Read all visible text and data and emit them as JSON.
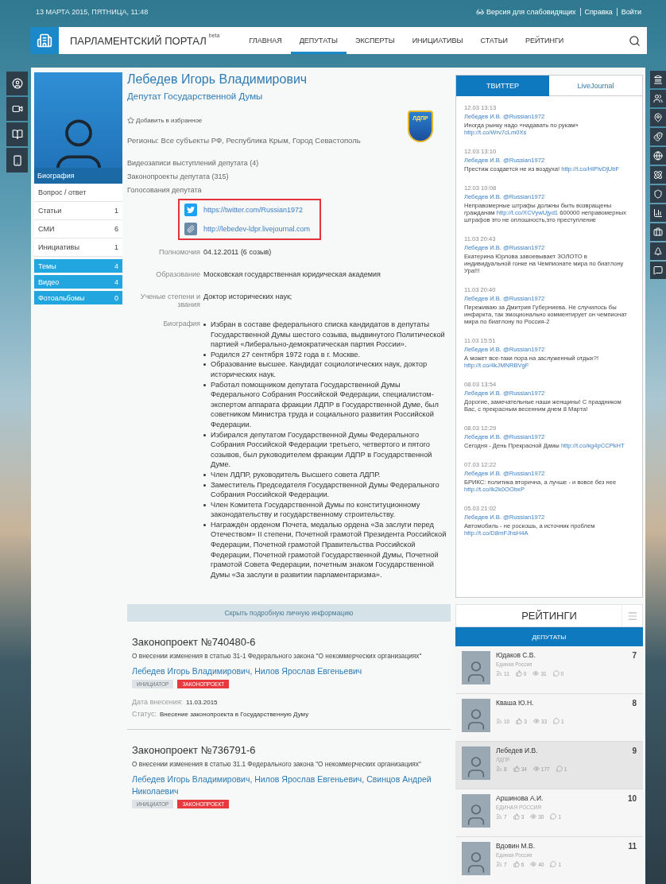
{
  "top_bar": {
    "date": "13 МАРТА 2015, ПЯТНИЦА, 11:48",
    "links": [
      {
        "label": "Версия для слабовидящих",
        "kind": "accessibility"
      },
      {
        "label": "Справка",
        "kind": "plain"
      },
      {
        "label": "Войти",
        "kind": "plain"
      }
    ]
  },
  "site": {
    "title": "ПАРЛАМЕНТСКИЙ ПОРТАЛ",
    "badge": "beta"
  },
  "nav": [
    {
      "label": "ГЛАВНАЯ",
      "selected": false
    },
    {
      "label": "ДЕПУТАТЫ",
      "selected": true
    },
    {
      "label": "ЭКСПЕРТЫ",
      "selected": false
    },
    {
      "label": "ИНИЦИАТИВЫ",
      "selected": false
    },
    {
      "label": "СТАТЬИ",
      "selected": false
    },
    {
      "label": "РЕЙТИНГИ",
      "selected": false
    }
  ],
  "side_menu": {
    "photo_caption": "Биография",
    "items": [
      {
        "label": "Вопрос / ответ",
        "kind": "plain"
      },
      {
        "label": "Статьи",
        "count": "1",
        "kind": "plain"
      },
      {
        "label": "СМИ",
        "count": "6",
        "kind": "plain"
      },
      {
        "label": "Инициативы",
        "count": "1",
        "kind": "plain"
      },
      {
        "label": "Темы",
        "count": "4",
        "kind": "accent"
      },
      {
        "label": "Видео",
        "count": "4",
        "kind": "accent"
      },
      {
        "label": "Фотоальбомы",
        "count": "0",
        "kind": "accent"
      }
    ]
  },
  "profile": {
    "name": "Лебедев Игорь Владимирович",
    "position": "Депутат Государственной Думы",
    "favorite": "Добавить в избранное",
    "party_logo": "ЛДПР",
    "regions": "Регионы: Все субъекты РФ, Республика Крым, Город Севастополь",
    "links": [
      "Видеозаписи выступлений депутата (4)",
      "Законопроекты депутата (315)",
      "Голосования депутата"
    ],
    "social": [
      {
        "kind": "twitter",
        "url": "https://twitter.com/Russian1972"
      },
      {
        "kind": "livejournal",
        "url": "http://lebedev-ldpr.livejournal.com"
      }
    ],
    "details": [
      {
        "label": "Полномочия",
        "value": "04.12.2011 (6 созыв)"
      },
      {
        "label": "Образование",
        "value": "Московская государственная юридическая академия"
      },
      {
        "label": "Ученые степени и звания",
        "value": "Доктор исторических наук;"
      }
    ],
    "biography": {
      "label": "Биография",
      "items": [
        "Избран в составе федерального списка кандидатов в депутаты Государственной Думы шестого созыва, выдвинутого Политической партией «Либерально-демократическая партия России».",
        "Родился 27 сентября 1972 года в г. Москве.",
        "Образование высшее. Кандидат социологических наук, доктор исторических наук.",
        "Работал помощником депутата Государственной Думы Федерального Собрания Российской Федерации, специалистом-экспертом аппарата фракции ЛДПР в Государственной Думе, был советником Министра труда и социального развития Российской Федерации.",
        "Избирался депутатом Государственной Думы Федерального Собрания Российской Федерации третьего, четвертого и пятого созывов, был руководителем фракции ЛДПР в Государственной Думе.",
        "Член ЛДПР, руководитель Высшего совета ЛДПР.",
        "Заместитель Председателя Государственной Думы Федерального Собрания Российской Федерации.",
        "Член Комитета Государственной Думы по конституционному законодательству и государственному строительству.",
        "Награждён орденом Почета, медалью ордена «За заслуги перед Отечеством» II степени, Почетной грамотой Президента Российской Федерации, Почетной грамотой Правительства Российской Федерации, Почетной грамотой Государственной Думы, Почетной грамотой Совета Федерации, почетным знаком Государственной Думы «За заслуги в развитии парламентаризма»."
      ]
    },
    "hide_button": "Скрыть подробную личную информацию"
  },
  "bills": [
    {
      "title": "Законопроект №740480-6",
      "description": "О внесении изменения в статью 31-1 Федерального закона \"О некоммерческих организациях\"",
      "authors": "Лебедев Игорь Владимирович, Нилов Ярослав Евгеньевич",
      "tags": [
        {
          "label": "ИНИЦИАТОР",
          "kind": "role"
        },
        {
          "label": "ЗАКОНОПРОЕКТ",
          "kind": "type"
        }
      ],
      "date_label": "Дата внесения:",
      "date": "11.03.2015",
      "status_label": "Статус:",
      "status": "Внесение законопроекта в Государственную Думу"
    },
    {
      "title": "Законопроект №736791-6",
      "description": "О внесении изменения в статью 31.1 Федерального закона \"О некоммерческих организациях\"",
      "authors": "Лебедев Игорь Владимирович, Нилов Ярослав Евгеньевич, Свинцов Андрей Николаевич",
      "tags": [
        {
          "label": "ИНИЦИАТОР",
          "kind": "role"
        },
        {
          "label": "ЗАКОНОПРОЕКТ",
          "kind": "type"
        }
      ]
    }
  ],
  "feed": {
    "tabs": [
      {
        "label": "ТВИТТЕР",
        "selected": true
      },
      {
        "label": "LiveJournal",
        "selected": false
      }
    ],
    "tweets": [
      {
        "time": "12.03 13:13",
        "author": "Лебедев И.В. @Russian1972",
        "text": "Иногда рынку надо «надавать по рукам»",
        "link": "http://t.co/Wrv7cLm0Xs"
      },
      {
        "time": "12.03 13:10",
        "author": "Лебедев И.В. @Russian1972",
        "text": "Престиж создается не из воздуха!",
        "link": "http://t.co/HIPlvDjUbF"
      },
      {
        "time": "12.03 10:08",
        "author": "Лебедев И.В. @Russian1972",
        "text": "Неправомерные штрафы должны быть возвращены гражданам",
        "link": "http://t.co/XCVywUjyd1",
        "after": "600000 неправомерных штрафов это не оплошность,это преступление"
      },
      {
        "time": "11.03 20:43",
        "author": "Лебедев И.В. @Russian1972",
        "text": "Екатерина Юрлова завоевывает ЗОЛОТО в индивидуальной гонке на Чемпионате мира по биатлону Ура!!!"
      },
      {
        "time": "11.03 20:40",
        "author": "Лебедев И.В. @Russian1972",
        "text": "Переживаю за Дмитрия Губерниева. Не случилось бы инфаркта, так эмоционально комментирует он чемпионат мира по биатлону по Россия-2"
      },
      {
        "time": "11.03 15:51",
        "author": "Лебедев И.В. @Russian1972",
        "text": "А может все-таки пора на заслуженный отдых?!",
        "link": "http://t.co/4kJMNRBVgF"
      },
      {
        "time": "08.03 13:54",
        "author": "Лебедев И.В. @Russian1972",
        "text": "Дорогие, замечательные наши женщины! С праздником Вас, с прекрасным весенним днем 8 Марта!"
      },
      {
        "time": "08.03 12:29",
        "author": "Лебедев И.В. @Russian1972",
        "text": "Сегодня - День Прекрасной Дамы",
        "link": "http://t.co/kg4pCCPkHT"
      },
      {
        "time": "07.03 12:22",
        "author": "Лебедев И.В. @Russian1972",
        "text": "БРИКС: политика вторична, а лучше - и вовсе без нее",
        "link": "http://t.co/lk2k0OObxP"
      },
      {
        "time": "05.03 21:02",
        "author": "Лебедев И.В. @Russian1972",
        "text": "Автомобиль - не роскошь, а источник проблем",
        "link": "http://t.co/D8mFJhsH4A"
      }
    ]
  },
  "ratings": {
    "title": "РЕЙТИНГИ",
    "tab": "ДЕПУТАТЫ",
    "items": [
      {
        "name": "Юдаков С.В.",
        "party": "Единая Россия",
        "rank": "7",
        "stats": [
          "11",
          "0",
          "31",
          "0"
        ],
        "selected": false
      },
      {
        "name": "Кваша Ю.Н.",
        "rank": "8",
        "stats": [
          "10",
          "3",
          "33",
          "1"
        ],
        "selected": false
      },
      {
        "name": "Лебедев И.В.",
        "party": "ЛДПР.",
        "rank": "9",
        "stats": [
          "8",
          "34",
          "177",
          "1"
        ],
        "selected": true
      },
      {
        "name": "Аршинова А.И.",
        "party": "ЕДИНАЯ РОССИЯ",
        "rank": "10",
        "stats": [
          "7",
          "3",
          "30",
          "1"
        ],
        "selected": false
      },
      {
        "name": "Вдовин М.В.",
        "party": "Единая Россия",
        "rank": "11",
        "stats": [
          "7",
          "6",
          "40",
          "1"
        ],
        "selected": false
      }
    ]
  }
}
